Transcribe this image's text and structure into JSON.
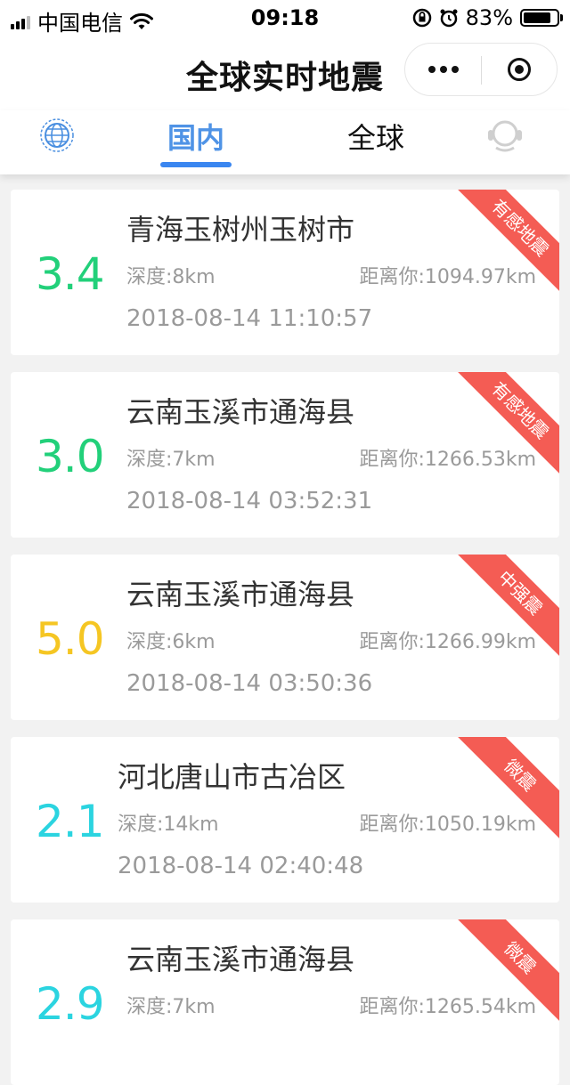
{
  "status_bar": {
    "carrier": "中国电信",
    "time": "09:18",
    "battery": "83%",
    "battery_level": 0.83
  },
  "navbar": {
    "title": "全球实时地震"
  },
  "tabs": [
    {
      "label": "国内",
      "active": true
    },
    {
      "label": "全球",
      "active": false
    }
  ],
  "colors": {
    "accent": "#3a86f0",
    "ribbon": "#f45c54",
    "mag_green": "#22d07a",
    "mag_yellow": "#f5c623",
    "mag_cyan": "#2bd4e0"
  },
  "quakes": [
    {
      "magnitude": "3.4",
      "mag_color": "#22d07a",
      "place": "青海玉树州玉树市",
      "depth": "深度:8km",
      "distance": "距离你:1094.97km",
      "time": "2018-08-14 11:10:57",
      "tag": "有感地震"
    },
    {
      "magnitude": "3.0",
      "mag_color": "#22d07a",
      "place": "云南玉溪市通海县",
      "depth": "深度:7km",
      "distance": "距离你:1266.53km",
      "time": "2018-08-14 03:52:31",
      "tag": "有感地震"
    },
    {
      "magnitude": "5.0",
      "mag_color": "#f5c623",
      "place": "云南玉溪市通海县",
      "depth": "深度:6km",
      "distance": "距离你:1266.99km",
      "time": "2018-08-14 03:50:36",
      "tag": "中强震"
    },
    {
      "magnitude": "2.1",
      "mag_color": "#2bd4e0",
      "place": "河北唐山市古冶区",
      "depth": "深度:14km",
      "distance": "距离你:1050.19km",
      "time": "2018-08-14 02:40:48",
      "tag": "微震"
    },
    {
      "magnitude": "2.9",
      "mag_color": "#2bd4e0",
      "place": "云南玉溪市通海县",
      "depth": "深度:7km",
      "distance": "距离你:1265.54km",
      "time": "",
      "tag": "微震"
    }
  ]
}
